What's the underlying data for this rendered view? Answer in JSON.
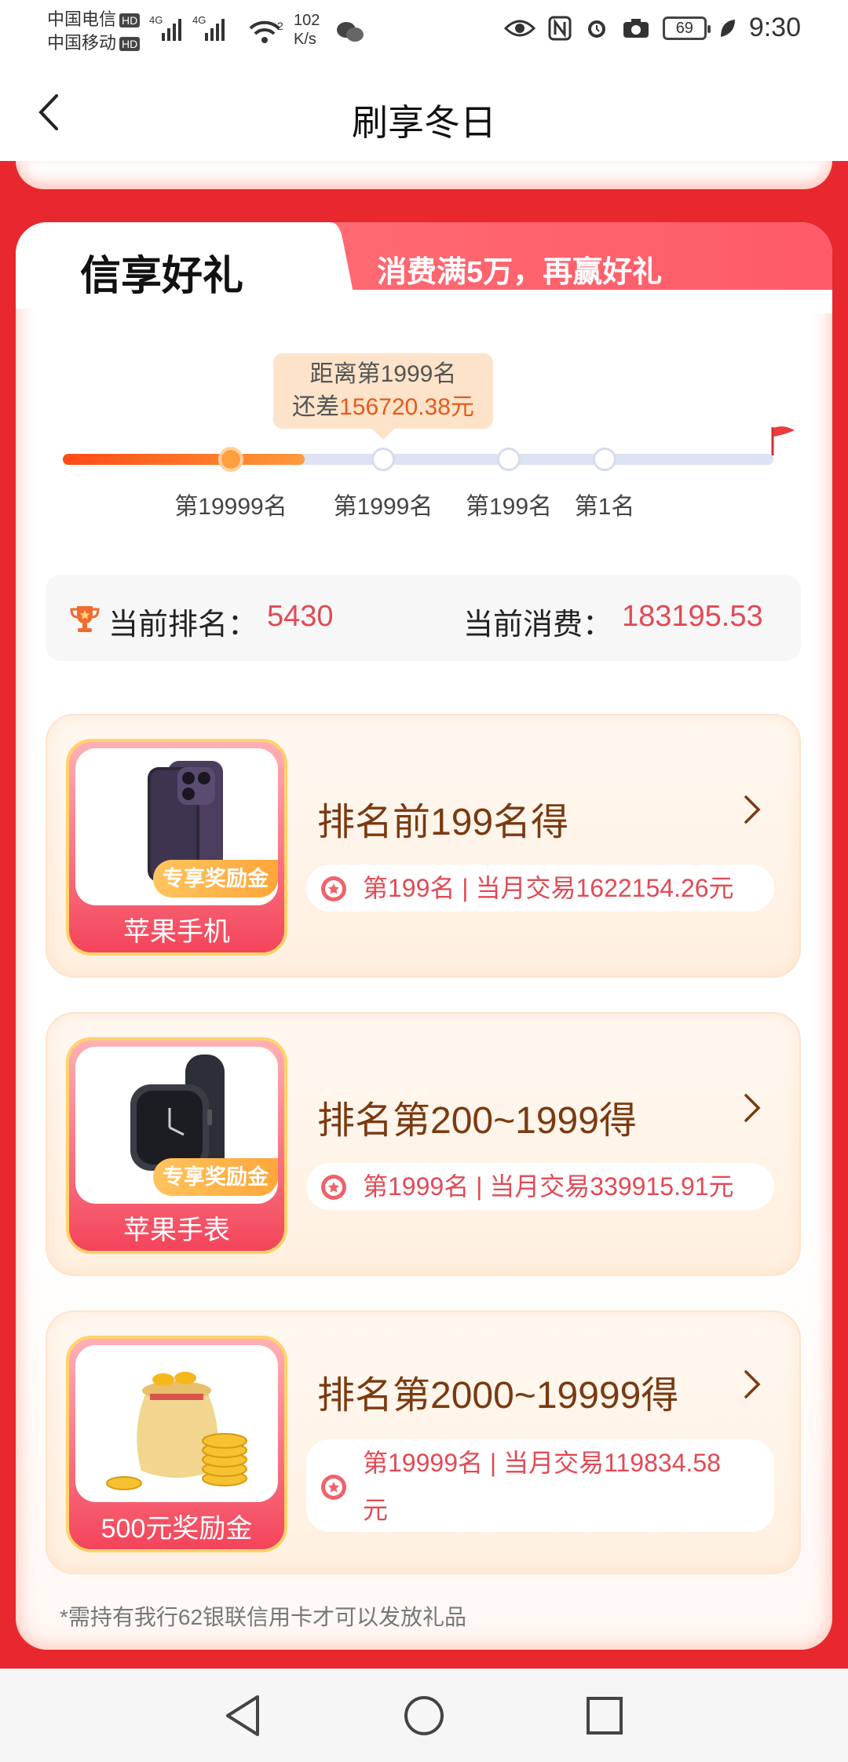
{
  "status_bar": {
    "carrier1": "中国电信",
    "carrier2": "中国移动",
    "hd": "HD",
    "net_tag": "4G",
    "wifi_sup": "2",
    "net_speed_value": "102",
    "net_speed_unit": "K/s",
    "battery": "69",
    "time": "9:30"
  },
  "nav": {
    "title": "刷享冬日"
  },
  "tabs": {
    "active": "信享好礼",
    "banner": "消费满5万，再赢好礼"
  },
  "progress": {
    "tooltip_line1": "距离第1999名",
    "tooltip_prefix": "还差",
    "tooltip_amount": "156720.38",
    "tooltip_suffix": "元",
    "fill_fraction": 0.313,
    "current_node_fraction": 0.217,
    "milestones": [
      "第19999名",
      "第1999名",
      "第199名",
      "第1名"
    ],
    "milestone_fractions": [
      0.217,
      0.414,
      0.577,
      0.7
    ]
  },
  "rank": {
    "rank_label": "当前排名：",
    "rank_value": "5430",
    "spend_label": "当前消费：",
    "spend_value": "183195.53"
  },
  "prizes": [
    {
      "thumb_name": "苹果手机",
      "badge": "专享奖励金",
      "title": "排名前199名得",
      "detail": "第199名 | 当月交易1622154.26元",
      "image": "iphone"
    },
    {
      "thumb_name": "苹果手表",
      "badge": "专享奖励金",
      "title": "排名第200~1999得",
      "detail": "第1999名 | 当月交易339915.91元",
      "image": "watch"
    },
    {
      "thumb_name": "500元奖励金",
      "badge": "",
      "title": "排名第2000~19999得",
      "detail_line1": "第19999名 | 当月交易119834.58",
      "detail_line2": "元",
      "image": "money-bag"
    }
  ],
  "footnote": "*需持有我行62银联信用卡才可以发放礼品",
  "colors": {
    "accent_red": "#e8282e",
    "value_red": "#e24a55",
    "prize_brown": "#7a3a12"
  }
}
